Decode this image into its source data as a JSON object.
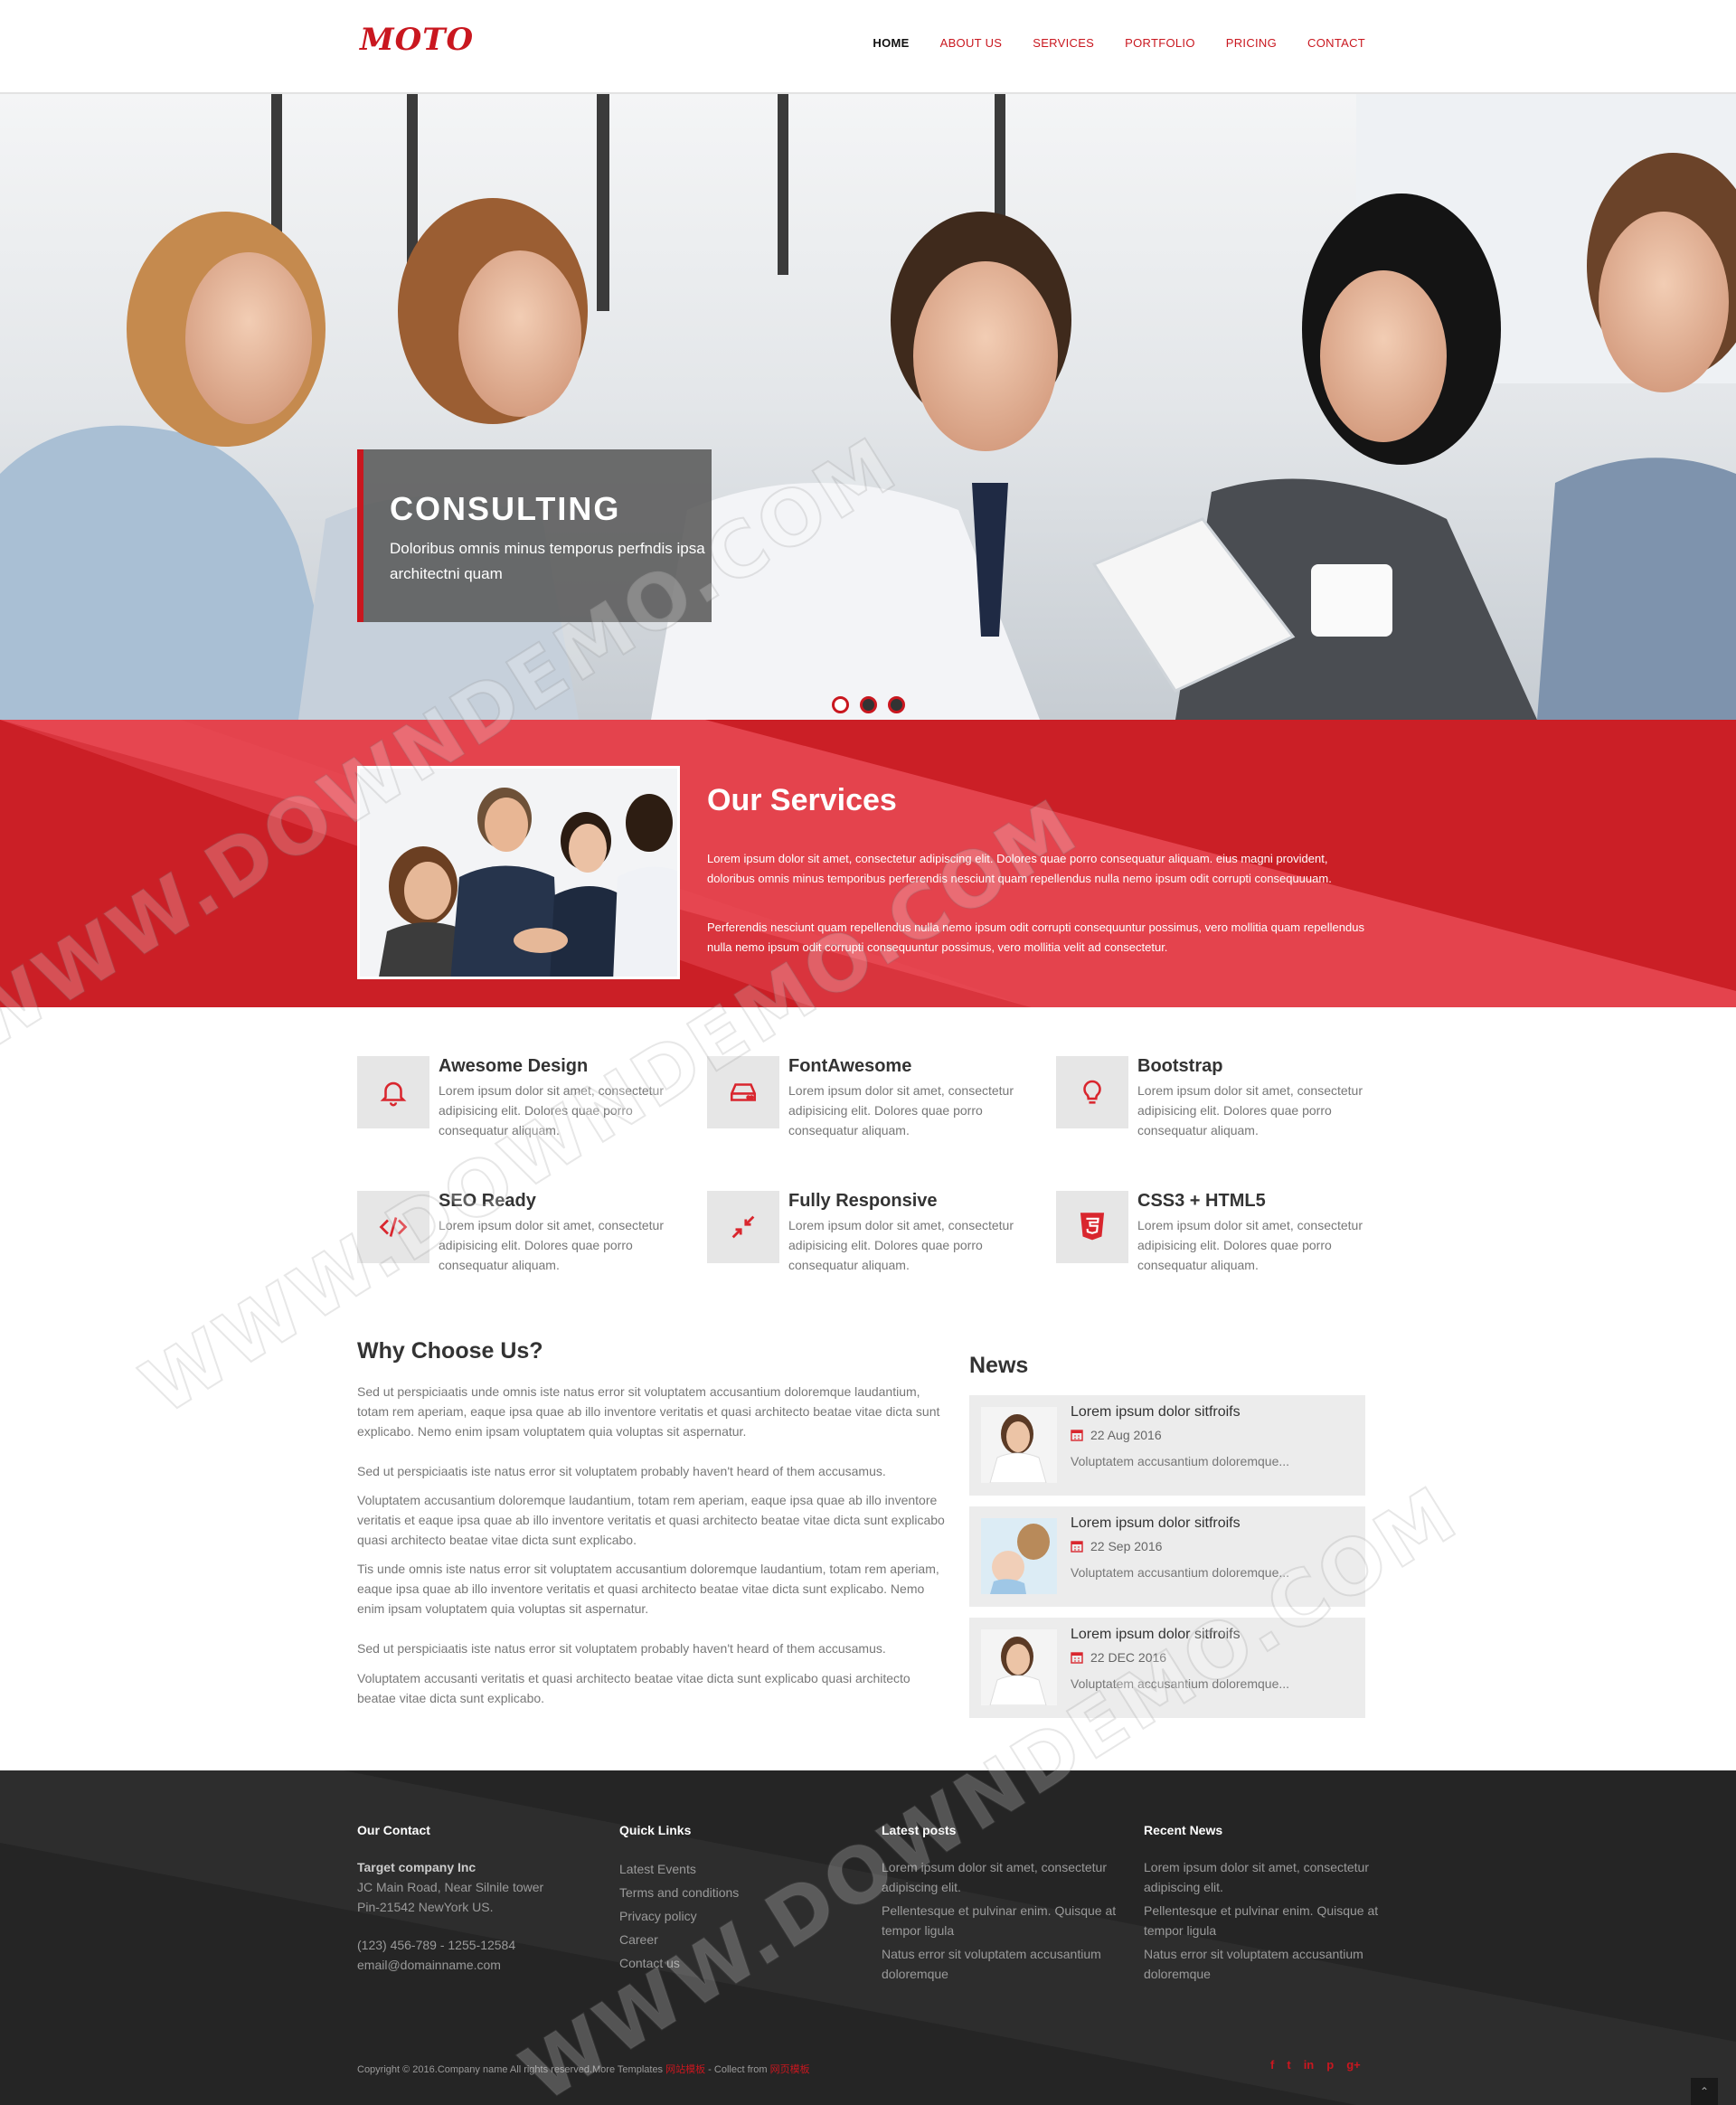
{
  "header": {
    "logo": "MOTO",
    "nav": [
      "HOME",
      "ABOUT US",
      "SERVICES",
      "PORTFOLIO",
      "PRICING",
      "CONTACT"
    ]
  },
  "hero": {
    "title": "CONSULTING",
    "subtitle": "Doloribus omnis minus temporus perfndis ipsa architectni quam",
    "slides_count": 3,
    "active_slide": 1
  },
  "services": {
    "title": "Our Services",
    "paragraph1": "Lorem ipsum dolor sit amet, consectetur adipiscing elit. Dolores quae porro consequatur aliquam. eius magni provident, doloribus omnis minus temporibus perferendis nesciunt quam repellendus nulla nemo ipsum odit corrupti consequuuam.",
    "paragraph2": "Perferendis nesciunt quam repellendus nulla nemo ipsum odit corrupti consequuntur possimus, vero mollitia quam repellendus nulla nemo ipsum odit corrupti consequuntur possimus, vero mollitia velit ad consectetur."
  },
  "features": [
    {
      "title": "Awesome Design",
      "text": "Lorem ipsum dolor sit amet, consectetur adipisicing elit. Dolores quae porro consequatur aliquam.",
      "icon": "bell-icon"
    },
    {
      "title": "FontAwesome",
      "text": "Lorem ipsum dolor sit amet, consectetur adipisicing elit. Dolores quae porro consequatur aliquam.",
      "icon": "hdd-icon"
    },
    {
      "title": "Bootstrap",
      "text": "Lorem ipsum dolor sit amet, consectetur adipisicing elit. Dolores quae porro consequatur aliquam.",
      "icon": "lightbulb-icon"
    },
    {
      "title": "SEO Ready",
      "text": "Lorem ipsum dolor sit amet, consectetur adipisicing elit. Dolores quae porro consequatur aliquam.",
      "icon": "code-icon"
    },
    {
      "title": "Fully Responsive",
      "text": "Lorem ipsum dolor sit amet, consectetur adipisicing elit. Dolores quae porro consequatur aliquam.",
      "icon": "compress-icon"
    },
    {
      "title": "CSS3 + HTML5",
      "text": "Lorem ipsum dolor sit amet, consectetur adipisicing elit. Dolores quae porro consequatur aliquam.",
      "icon": "html5-icon"
    }
  ],
  "why": {
    "title": "Why Choose Us?",
    "paragraphs": [
      "Sed ut perspiciaatis unde omnis iste natus error sit voluptatem accusantium doloremque laudantium, totam rem aperiam, eaque ipsa quae ab illo inventore veritatis et quasi architecto beatae vitae dicta sunt explicabo. Nemo enim ipsam voluptatem quia voluptas sit aspernatur.",
      "Sed ut perspiciaatis iste natus error sit voluptatem probably haven't heard of them accusamus.",
      "Voluptatem accusantium doloremque laudantium, totam rem aperiam, eaque ipsa quae ab illo inventore veritatis et eaque ipsa quae ab illo inventore veritatis et quasi architecto beatae vitae dicta sunt explicabo quasi architecto beatae vitae dicta sunt explicabo.",
      "Tis unde omnis iste natus error sit voluptatem accusantium doloremque laudantium, totam rem aperiam, eaque ipsa quae ab illo inventore veritatis et quasi architecto beatae vitae dicta sunt explicabo. Nemo enim ipsam voluptatem quia voluptas sit aspernatur.",
      "Sed ut perspiciaatis iste natus error sit voluptatem probably haven't heard of them accusamus.",
      "Voluptatem accusanti veritatis et quasi architecto beatae vitae dicta sunt explicabo quasi architecto beatae vitae dicta sunt explicabo."
    ]
  },
  "news": {
    "title": "News",
    "items": [
      {
        "title": "Lorem ipsum dolor sitfroifs",
        "date": "22 Aug 2016",
        "excerpt": "Voluptatem accusantium doloremque..."
      },
      {
        "title": "Lorem ipsum dolor sitfroifs",
        "date": "22 Sep 2016",
        "excerpt": "Voluptatem accusantium doloremque..."
      },
      {
        "title": "Lorem ipsum dolor sitfroifs",
        "date": "22 DEC 2016",
        "excerpt": "Voluptatem accusantium doloremque..."
      }
    ]
  },
  "footer": {
    "contact": {
      "title": "Our Contact",
      "company": "Target company Inc",
      "address1": "JC Main Road, Near Silnile tower",
      "address2": "Pin-21542 NewYork US.",
      "phone": "(123) 456-789 - 1255-12584",
      "email": "email@domainname.com"
    },
    "quick_links": {
      "title": "Quick Links",
      "items": [
        "Latest Events",
        "Terms and conditions",
        "Privacy policy",
        "Career",
        "Contact us"
      ]
    },
    "latest_posts": {
      "title": "Latest posts",
      "items": [
        "Lorem ipsum dolor sit amet, consectetur adipiscing elit.",
        "Pellentesque et pulvinar enim. Quisque at tempor ligula",
        "Natus error sit voluptatem accusantium doloremque"
      ]
    },
    "recent_news": {
      "title": "Recent News",
      "items": [
        "Lorem ipsum dolor sit amet, consectetur adipiscing elit.",
        "Pellentesque et pulvinar enim. Quisque at tempor ligula",
        "Natus error sit voluptatem accusantium doloremque"
      ]
    },
    "copyright_prefix": "Copyright © 2016.Company name All rights reserved.More Templates ",
    "copyright_link1": "网站模板",
    "copyright_mid": " - Collect from ",
    "copyright_link2": "网页模板",
    "social": [
      "f",
      "t",
      "in",
      "p",
      "g+"
    ]
  },
  "watermark": "WWW.DOWNDEMO.COM",
  "colors": {
    "accent": "#c9171f",
    "band_light": "#e4434d",
    "footer_bg": "#252525"
  }
}
